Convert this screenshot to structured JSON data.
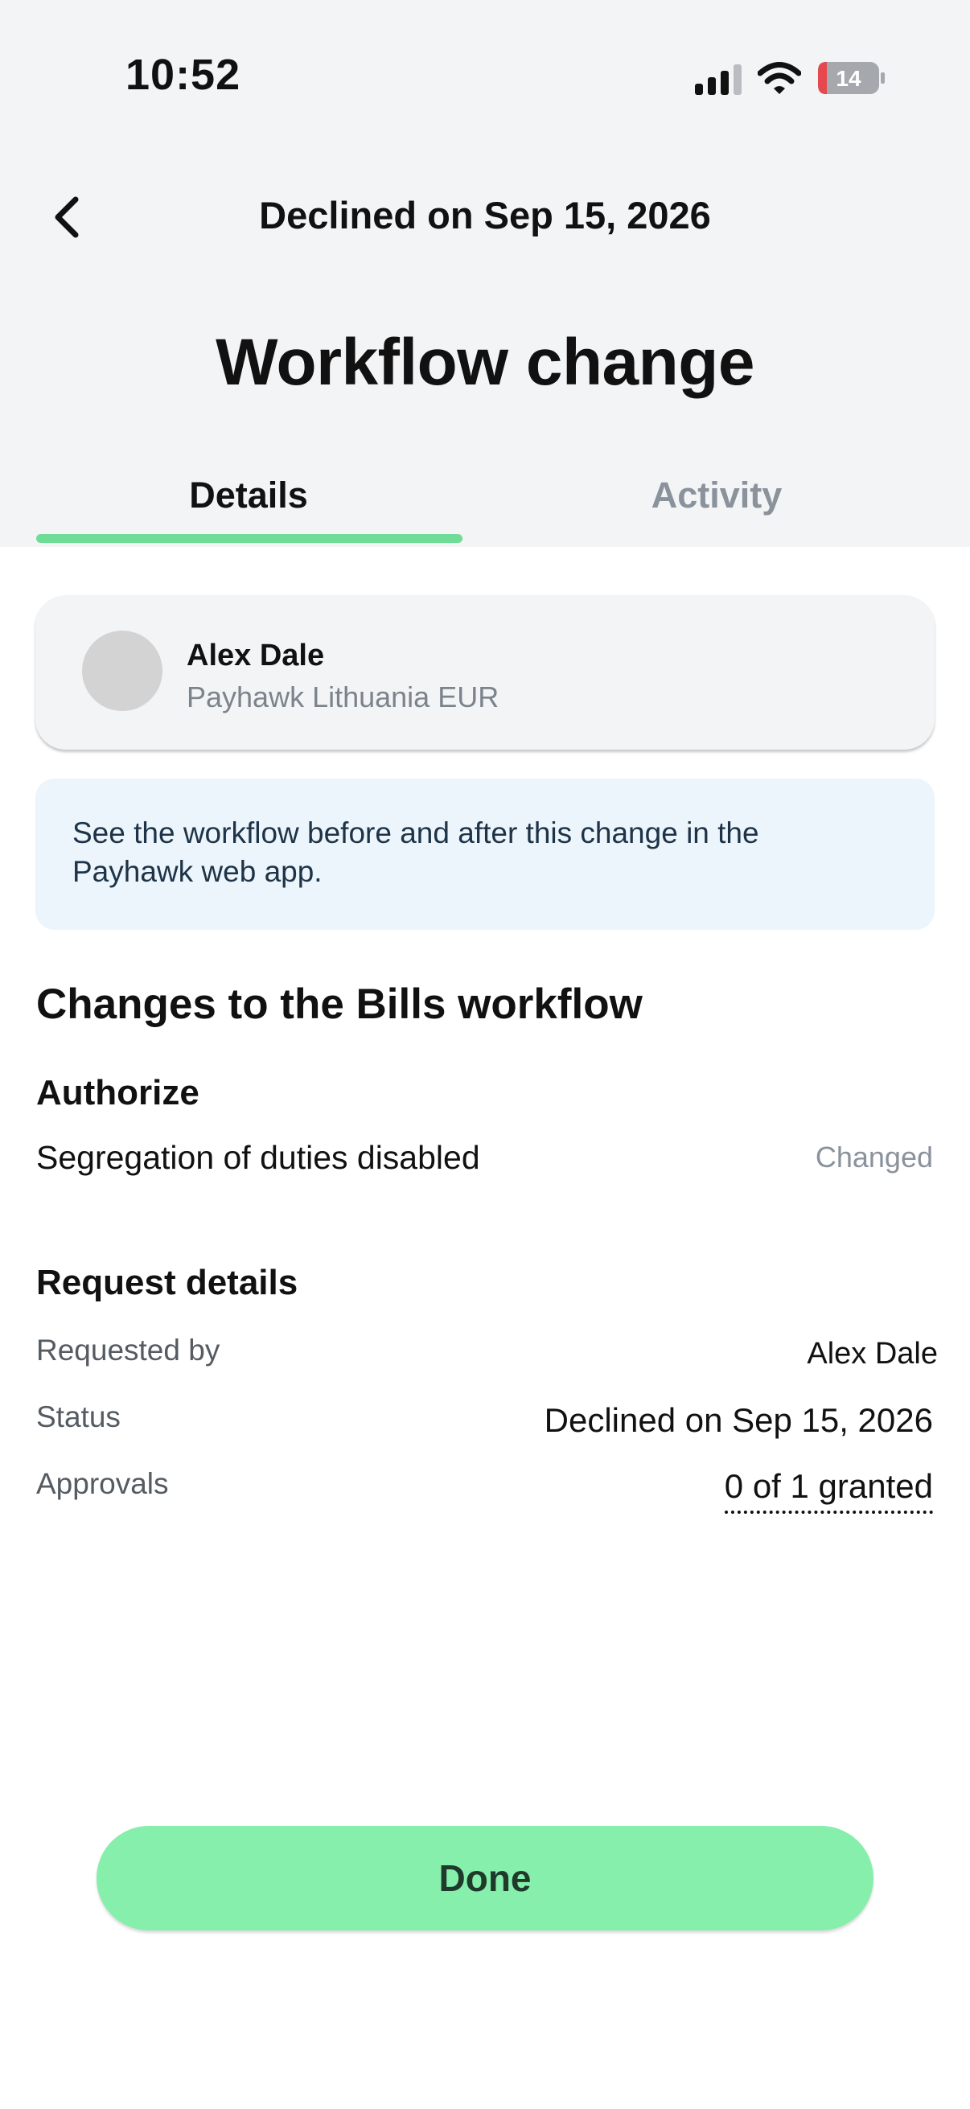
{
  "status_bar": {
    "time": "10:52",
    "battery": "14"
  },
  "header": {
    "nav_title": "Declined on Sep 15, 2026",
    "page_title": "Workflow change"
  },
  "tabs": [
    {
      "label": "Details",
      "active": true
    },
    {
      "label": "Activity",
      "active": false
    }
  ],
  "user": {
    "name": "Alex Dale",
    "company": "Payhawk Lithuania EUR"
  },
  "info": {
    "text": "See the workflow before and after this change in the Payhawk web app."
  },
  "changes": {
    "heading": "Changes to the Bills workflow",
    "group": "Authorize",
    "item_label": "Segregation of duties disabled",
    "item_status": "Changed"
  },
  "request_details": {
    "heading": "Request details",
    "rows": [
      {
        "label": "Requested by",
        "value": "Alex Dale"
      },
      {
        "label": "Status",
        "value": "Declined on Sep 15, 2026"
      },
      {
        "label": "Approvals",
        "value": "0 of 1 granted"
      }
    ]
  },
  "actions": {
    "done_label": "Done"
  },
  "colors": {
    "accent": "#6fdc97",
    "button": "#86efac",
    "header_bg": "#f3f4f6",
    "info_bg": "#ebf5fb"
  },
  "icons": [
    "back-chevron-icon",
    "cellular-signal-icon",
    "wifi-icon",
    "battery-icon"
  ]
}
